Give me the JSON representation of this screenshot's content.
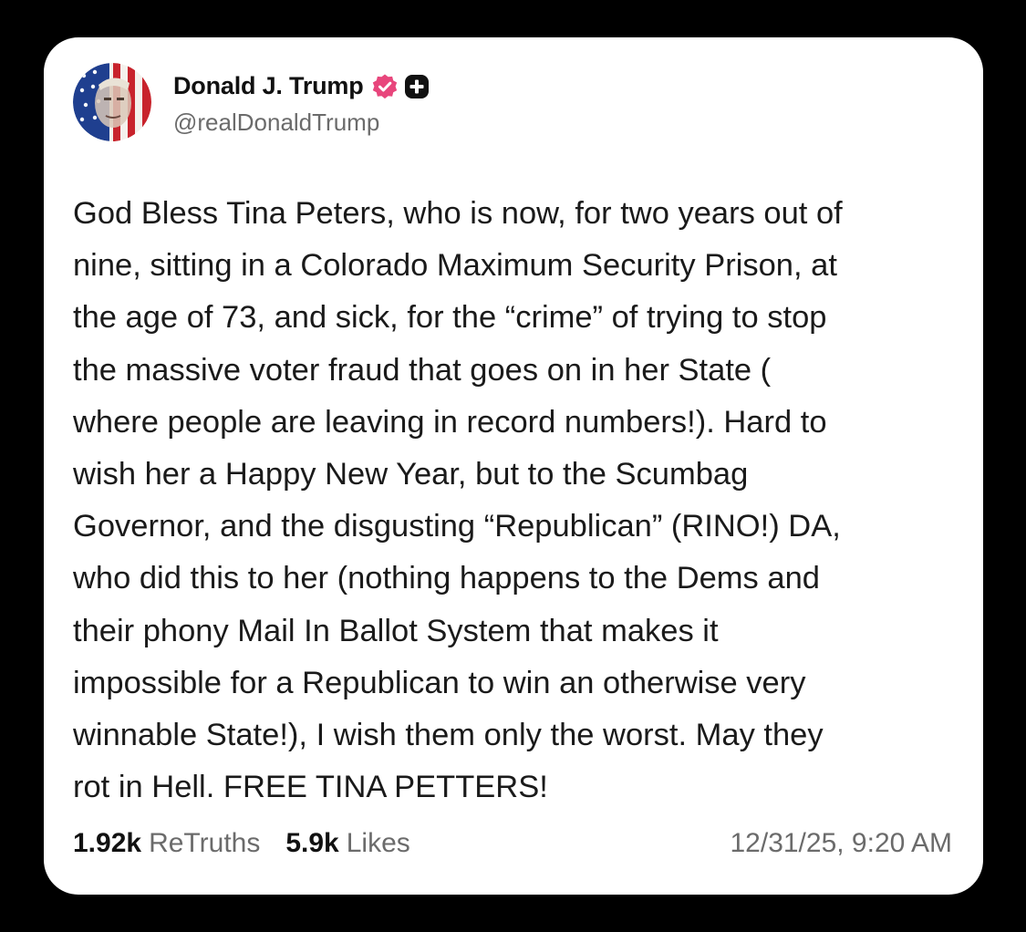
{
  "post": {
    "author": {
      "display_name": "Donald J. Trump",
      "handle": "@realDonaldTrump",
      "avatar_icon": "flag-portrait-avatar",
      "verified_icon": "verified-badge-icon",
      "badge_icon": "plus-badge-icon"
    },
    "body_lines": [
      "God Bless Tina Peters, who is now, for two years out of",
      "nine, sitting in a Colorado Maximum Security Prison, at",
      "the age of 73, and sick, for the “crime” of trying to stop",
      "the massive voter fraud that goes on in her State (",
      "where people are leaving in record numbers!). Hard to",
      "wish her a Happy New Year, but to the Scumbag",
      "Governor, and the disgusting “Republican” (RINO!) DA,",
      "who did this to her (nothing happens to the Dems and",
      "their phony Mail In Ballot System that makes it",
      "impossible for a Republican to win an otherwise very",
      "winnable State!), I wish them only the worst. May they",
      "rot in Hell. FREE TINA PETTERS!"
    ],
    "stats": {
      "retruths_count": "1.92k",
      "retruths_label": "ReTruths",
      "likes_count": "5.9k",
      "likes_label": "Likes"
    },
    "timestamp": "12/31/25, 9:20 AM"
  },
  "colors": {
    "background": "#000000",
    "card": "#ffffff",
    "verified_pink": "#e8467c",
    "text_primary": "#1a1a1a",
    "text_secondary": "#6b6b6b"
  }
}
